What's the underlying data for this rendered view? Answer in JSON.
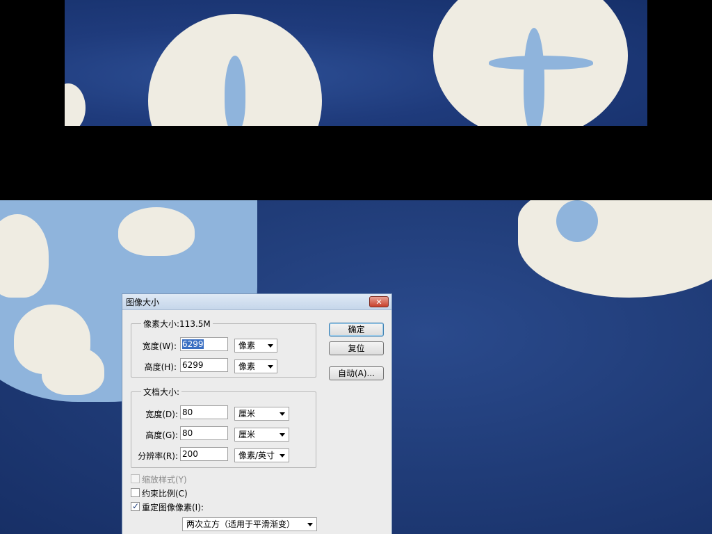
{
  "dialog": {
    "title": "图像大小",
    "close_glyph": "✕",
    "pixel_dimensions": {
      "legend": "像素大小:113.5M",
      "width_label": "宽度(W):",
      "width_value": "6299",
      "width_unit": "像素",
      "height_label": "高度(H):",
      "height_value": "6299",
      "height_unit": "像素"
    },
    "document_size": {
      "legend": "文档大小:",
      "width_label": "宽度(D):",
      "width_value": "80",
      "width_unit": "厘米",
      "height_label": "高度(G):",
      "height_value": "80",
      "height_unit": "厘米",
      "resolution_label": "分辨率(R):",
      "resolution_value": "200",
      "resolution_unit": "像素/英寸"
    },
    "buttons": {
      "ok": "确定",
      "reset": "复位",
      "auto": "自动(A)..."
    },
    "options": {
      "scale_styles": "缩放样式(Y)",
      "constrain_proportions": "约束比例(C)",
      "resample": "重定图像像素(I):",
      "resample_method": "两次立方（适用于平滑渐变）"
    }
  },
  "colors": {
    "indigo": "#1f3b7c",
    "petal": "#efece2",
    "petal_blue": "#8fb4dc"
  }
}
